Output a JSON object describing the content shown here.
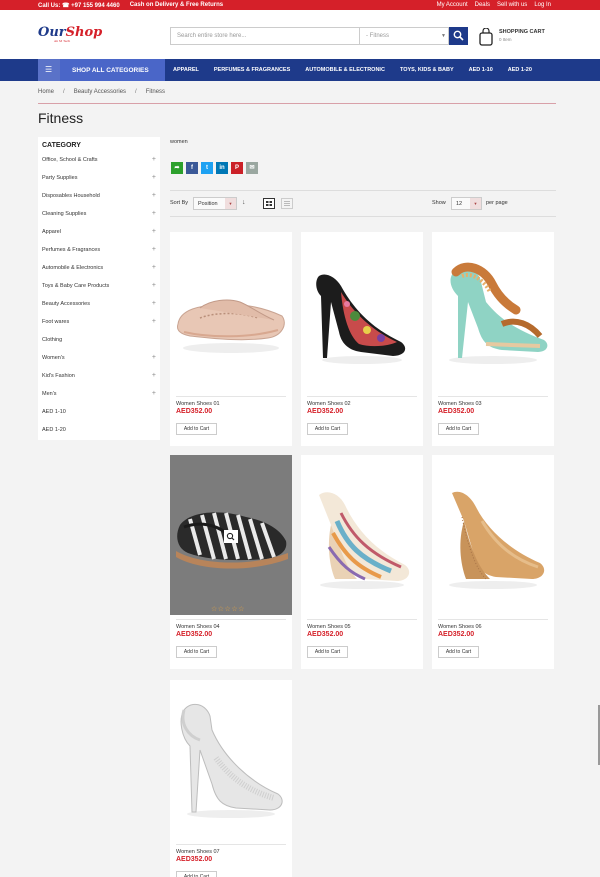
{
  "topbar": {
    "call": "Call Us: ☎ +97 155 994 4460",
    "delivery": "Cash on Delivery & Free Returns",
    "links": [
      "My Account",
      "Deals",
      "Sell with us",
      "Log In"
    ]
  },
  "header": {
    "logo_main": "Our",
    "logo_accent": "Shop",
    "logo_tag": "An M Tech",
    "search_placeholder": "Search entire store here...",
    "search_category": "- Fitness",
    "cart_title": "SHOPPING CART",
    "cart_items": "0 Item"
  },
  "nav": {
    "shop_all": "SHOP ALL CATEGORIES",
    "links": [
      "APPAREL",
      "PERFUMES & FRAGRANCES",
      "AUTOMOBILE & ELECTRONIC",
      "TOYS, KIDS & BABY",
      "AED 1-10",
      "AED 1-20"
    ]
  },
  "breadcrumb": [
    "Home",
    "Beauty Accessories",
    "Fitness"
  ],
  "page_title": "Fitness",
  "sidebar": {
    "title": "CATEGORY",
    "items": [
      {
        "label": "Office, School & Crafts",
        "expand": "+"
      },
      {
        "label": "Party Supplies",
        "expand": "+"
      },
      {
        "label": "Disposables Household",
        "expand": "+"
      },
      {
        "label": "Cleaning Supplies",
        "expand": "+"
      },
      {
        "label": "Apparel",
        "expand": "+"
      },
      {
        "label": "Perfumes & Fragrances",
        "expand": "+"
      },
      {
        "label": "Automobile & Electronics",
        "expand": "+"
      },
      {
        "label": "Toys & Baby Care Products",
        "expand": "+"
      },
      {
        "label": "Beauty Accessories",
        "expand": "+"
      },
      {
        "label": "Foot wares",
        "expand": "+"
      },
      {
        "label": "Clothing",
        "expand": ""
      },
      {
        "label": "Women's",
        "expand": "+"
      },
      {
        "label": "Kid's Fashion",
        "expand": "+"
      },
      {
        "label": "Men's",
        "expand": "+"
      },
      {
        "label": "AED 1-10",
        "expand": ""
      },
      {
        "label": "AED 1-20",
        "expand": ""
      }
    ]
  },
  "toolbar": {
    "subcategory": "women",
    "share": [
      {
        "icon": "share-icon",
        "glyph": "➦",
        "color": "#2ca02c"
      },
      {
        "icon": "facebook-icon",
        "glyph": "f",
        "color": "#3b5998"
      },
      {
        "icon": "twitter-icon",
        "glyph": "t",
        "color": "#1da1f2"
      },
      {
        "icon": "linkedin-icon",
        "glyph": "in",
        "color": "#0077b5"
      },
      {
        "icon": "pinterest-icon",
        "glyph": "P",
        "color": "#cb2027"
      },
      {
        "icon": "email-icon",
        "glyph": "✉",
        "color": "#9aa7a0"
      }
    ],
    "sort_label": "Sort By",
    "sort_value": "Position",
    "sort_direction": "↓",
    "show_label": "Show",
    "show_value": "12",
    "per_page": "per page"
  },
  "products": [
    {
      "name": "Women Shoes 01",
      "price": "AED352.00",
      "button": "Add to Cart",
      "shoe": "loafer",
      "rating": "",
      "hovered": false
    },
    {
      "name": "Women Shoes 02",
      "price": "AED352.00",
      "button": "Add to Cart",
      "shoe": "floral-pump",
      "rating": "",
      "hovered": false
    },
    {
      "name": "Women Shoes 03",
      "price": "AED352.00",
      "button": "Add to Cart",
      "shoe": "jeweled-sandal",
      "rating": "",
      "hovered": false
    },
    {
      "name": "Women Shoes 04",
      "price": "AED352.00",
      "button": "Add to Cart",
      "shoe": "espadrille",
      "rating": "☆☆☆☆☆",
      "hovered": true
    },
    {
      "name": "Women Shoes 05",
      "price": "AED352.00",
      "button": "Add to Cart",
      "shoe": "striped-wedge",
      "rating": "",
      "hovered": false
    },
    {
      "name": "Women Shoes 06",
      "price": "AED352.00",
      "button": "Add to Cart",
      "shoe": "cork-wedge",
      "rating": "",
      "hovered": false
    },
    {
      "name": "Women Shoes 07",
      "price": "AED352.00",
      "button": "Add to Cart",
      "shoe": "slingback-heel",
      "rating": "",
      "hovered": false
    }
  ],
  "colors": {
    "red": "#d52029",
    "navy": "#1e3a8a",
    "accent": "#4a66c8"
  }
}
